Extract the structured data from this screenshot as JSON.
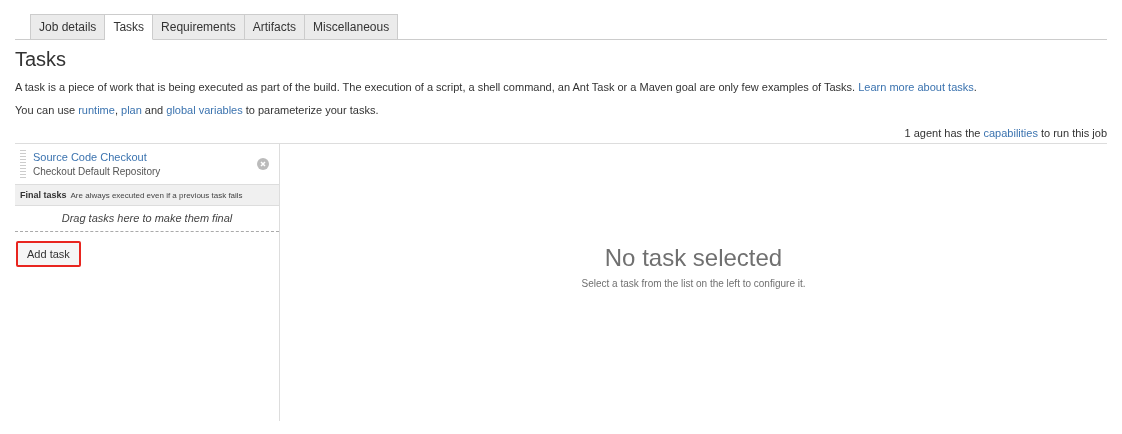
{
  "tabs": [
    {
      "label": "Job details",
      "selected": false
    },
    {
      "label": "Tasks",
      "selected": true
    },
    {
      "label": "Requirements",
      "selected": false
    },
    {
      "label": "Artifacts",
      "selected": false
    },
    {
      "label": "Miscellaneous",
      "selected": false
    }
  ],
  "heading": "Tasks",
  "paragraphs": [
    [
      {
        "text": "A task is a piece of work that is being executed as part of the build. The execution of a script, a shell command, an Ant Task or a Maven goal are only few examples of Tasks. ",
        "kind": "text"
      },
      {
        "text": "Learn more about tasks",
        "kind": "link"
      },
      {
        "text": ".",
        "kind": "text"
      }
    ],
    [
      {
        "text": "You can use ",
        "kind": "text"
      },
      {
        "text": "runtime",
        "kind": "link"
      },
      {
        "text": ", ",
        "kind": "text"
      },
      {
        "text": "plan",
        "kind": "link"
      },
      {
        "text": " and ",
        "kind": "text"
      },
      {
        "text": "global variables",
        "kind": "link"
      },
      {
        "text": " to parameterize your tasks.",
        "kind": "text"
      }
    ]
  ],
  "agents": [
    {
      "text": "1 agent has the ",
      "kind": "text"
    },
    {
      "text": "capabilities",
      "kind": "link"
    },
    {
      "text": " to run this job",
      "kind": "text"
    }
  ],
  "task_list": [
    {
      "name": "Source Code Checkout",
      "description": "Checkout Default Repository"
    }
  ],
  "final_tasks": {
    "title": "Final tasks",
    "note": "Are always executed even if a previous task fails",
    "drop_hint": "Drag tasks here to make them final"
  },
  "add_task": {
    "label": "Add task",
    "highlighted": true
  },
  "empty_state": {
    "title": "No task selected",
    "hint": "Select a task from the list on the left to configure it."
  }
}
